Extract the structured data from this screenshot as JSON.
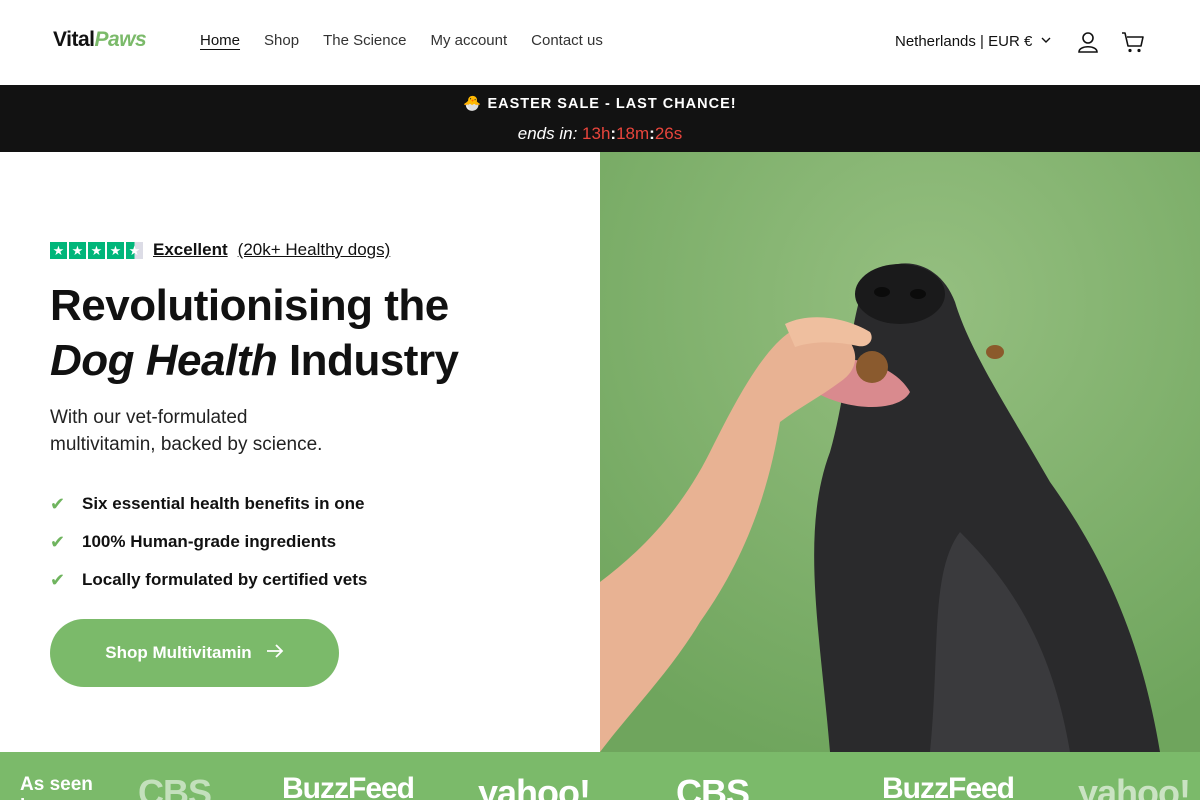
{
  "header": {
    "logo": {
      "part1": "Vital",
      "part2": "Paws"
    },
    "nav": [
      {
        "label": "Home",
        "active": true
      },
      {
        "label": "Shop",
        "active": false
      },
      {
        "label": "The Science",
        "active": false
      },
      {
        "label": "My account",
        "active": false
      },
      {
        "label": "Contact us",
        "active": false
      }
    ],
    "locale": "Netherlands | EUR €",
    "icons": [
      "user-icon",
      "cart-icon",
      "chevron-down-icon"
    ]
  },
  "announcement": {
    "title": "🐣 EASTER SALE - LAST CHANCE!",
    "ends_label": "ends in:",
    "hours": "13h",
    "minutes": "18m",
    "seconds": "26s",
    "separator": ":"
  },
  "hero": {
    "rating": {
      "stars_value": 4.5,
      "excellent": "Excellent",
      "count": "(20k+ Healthy dogs)"
    },
    "headline": {
      "line1": "Revolutionising the",
      "line2_em": "Dog Health",
      "line2_rest": " Industry"
    },
    "subline": "With our vet-formulated multivitamin, backed by science.",
    "benefits": [
      "Six essential health benefits in one",
      "100% Human-grade ingredients",
      "Locally formulated by certified vets"
    ],
    "cta": "Shop Multivitamin"
  },
  "seen_in": {
    "label": "As seen in",
    "logos": [
      "CBS",
      "BuzzFeed",
      "yahoo!",
      "CBS",
      "BuzzFeed",
      "yahoo!"
    ]
  },
  "colors": {
    "brand_green": "#7bba6a",
    "announcement_bg": "#121212",
    "timer_red": "#e8453c",
    "trustpilot_green": "#00b67a"
  }
}
